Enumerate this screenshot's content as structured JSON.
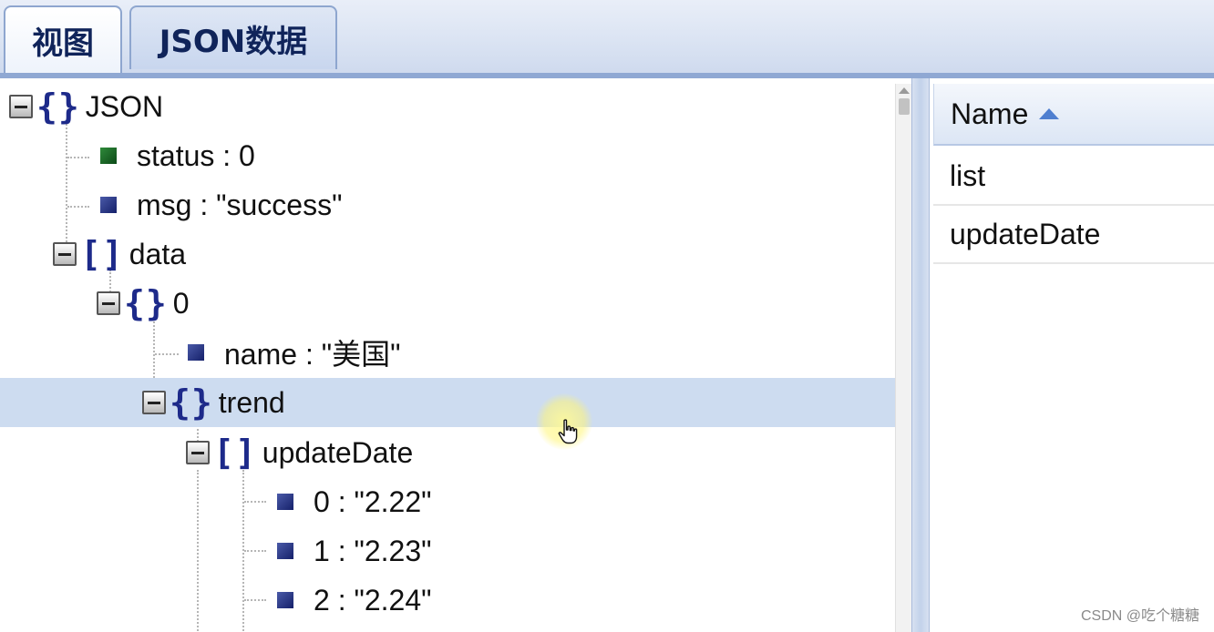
{
  "tabs": [
    {
      "label": "视图",
      "active": true
    },
    {
      "label": "JSON数据",
      "active": false
    }
  ],
  "tree": {
    "root": {
      "label": "JSON",
      "kind": "object"
    },
    "status": {
      "key": "status",
      "value": "0",
      "text": "status : 0"
    },
    "msg": {
      "key": "msg",
      "value": "\"success\"",
      "text": "msg : \"success\""
    },
    "data": {
      "label": "data",
      "kind": "array"
    },
    "item0": {
      "label": "0",
      "kind": "object"
    },
    "name": {
      "key": "name",
      "value": "\"美国\"",
      "text": "name : \"美国\""
    },
    "trend": {
      "label": "trend",
      "kind": "object",
      "selected": true
    },
    "updateDate": {
      "label": "updateDate",
      "kind": "array"
    },
    "dates": [
      {
        "text": "0 : \"2.22\""
      },
      {
        "text": "1 : \"2.23\""
      },
      {
        "text": "2 : \"2.24\""
      }
    ]
  },
  "table": {
    "header": "Name",
    "sort": "ascending",
    "rows": [
      {
        "name": "list"
      },
      {
        "name": "updateDate"
      }
    ]
  },
  "icons": {
    "expanded": "minus-toggle-icon",
    "object": "curly-braces-icon",
    "array": "square-brackets-icon",
    "leaf": "value-square-icon",
    "sort": "sort-ascending-icon",
    "cursor": "hand-pointer-icon"
  },
  "colors": {
    "selected_row": "#cddcf0",
    "brace": "#1d2a8a",
    "leaf_green": "#1c6b2a",
    "leaf_blue": "#233080",
    "tab_border": "#8ea6cf"
  },
  "watermark": "CSDN @吃个糖糖"
}
